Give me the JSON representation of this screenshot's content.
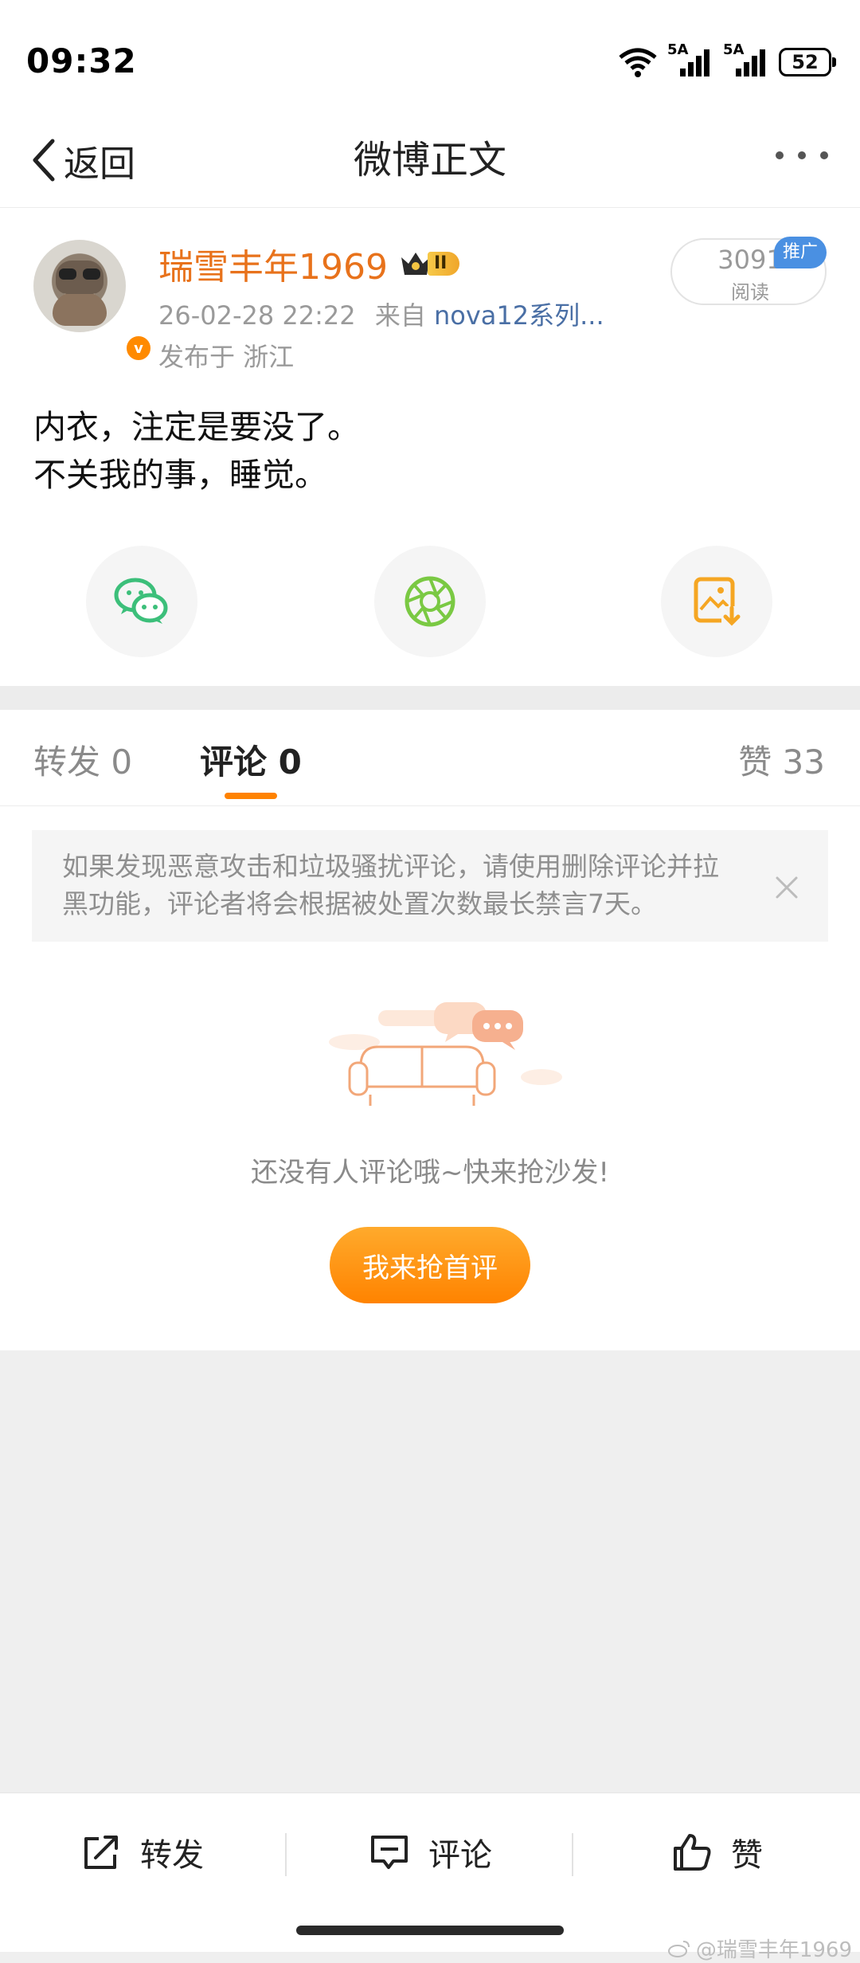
{
  "status": {
    "time": "09:32",
    "signal1": "5A",
    "signal2": "5A",
    "battery": "52"
  },
  "header": {
    "back_label": "返回",
    "title": "微博正文"
  },
  "post": {
    "username": "瑞雪丰年1969",
    "level_badge": "II",
    "datetime": "26-02-28 22:22",
    "source_prefix": "来自",
    "source": "nova12系列...",
    "location": "发布于 浙江",
    "reads_count": "3091",
    "reads_label": "阅读",
    "promo_label": "推广",
    "text_line1": "内衣，注定是要没了。",
    "text_line2": "不关我的事，睡觉。"
  },
  "tabs": {
    "repost": "转发 0",
    "comment": "评论 0",
    "like": "赞 33"
  },
  "comments": {
    "notice": "如果发现恶意攻击和垃圾骚扰评论，请使用删除评论并拉黑功能，评论者将会根据被处置次数最长禁言7天。",
    "empty_text": "还没有人评论哦~快来抢沙发!",
    "first_comment_button": "我来抢首评"
  },
  "bottom_bar": {
    "repost": "转发",
    "comment": "评论",
    "like": "赞"
  },
  "watermark": "@瑞雪丰年1969",
  "colors": {
    "accent": "#ff8200",
    "username": "#e8721b",
    "wechat": "#3cbf7a",
    "moments": "#7ac943",
    "save": "#f5a623"
  }
}
